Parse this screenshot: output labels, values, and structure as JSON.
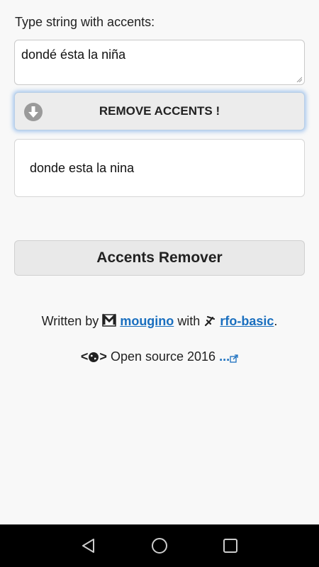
{
  "prompt_label": "Type string with accents:",
  "input": {
    "value": "dondé ésta la niña"
  },
  "remove_button": {
    "label": "REMOVE ACCENTS !",
    "icon": "arrow-down-circle-icon"
  },
  "output": {
    "value": "donde esta la nina"
  },
  "app_title_button": {
    "label": "Accents Remover"
  },
  "credits": {
    "written_by": "Written by",
    "author": "mougino",
    "author_icon": "mougino-logo-icon",
    "with": "with",
    "tool": "rfo-basic",
    "tool_icon": "rfo-basic-icon",
    "period": "."
  },
  "open_source": {
    "code_icon_open": "<",
    "globe_icon": "globe-icon",
    "code_icon_close": ">",
    "text": "Open source 2016",
    "more": "...",
    "external_icon": "external-link-icon"
  },
  "colors": {
    "link": "#1a6fbf",
    "focus_glow": "#64a0e6",
    "background": "#f8f8f8"
  },
  "navbar": {
    "back": "back-icon",
    "home": "home-icon",
    "recents": "recents-icon"
  }
}
